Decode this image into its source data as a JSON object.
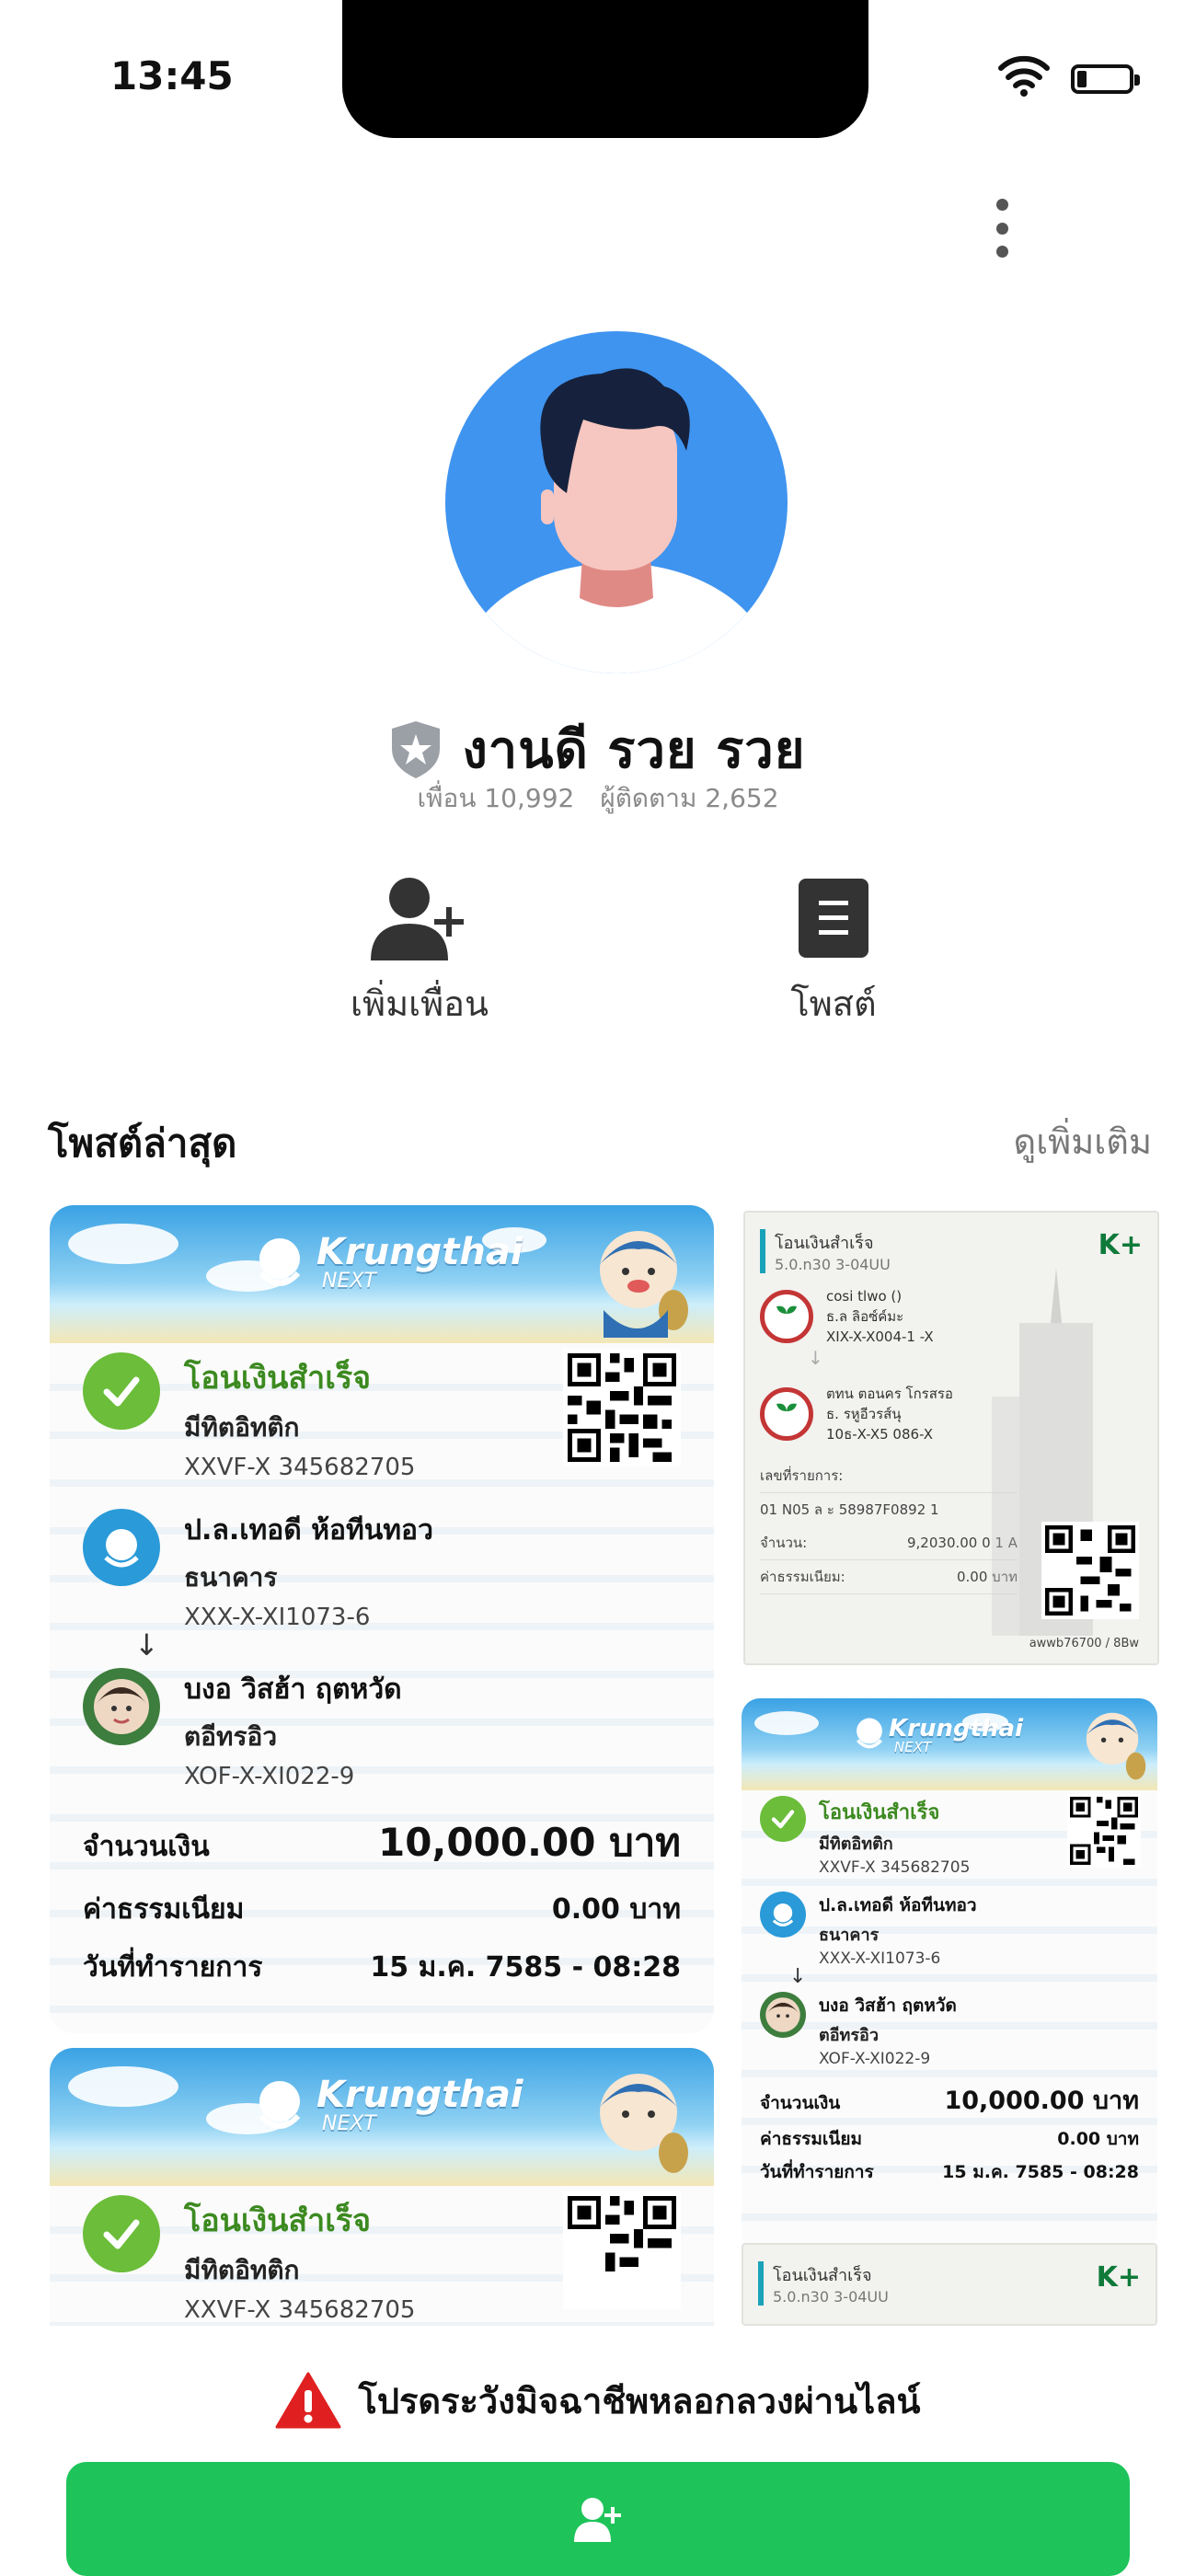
{
  "status_bar": {
    "time": "13:45"
  },
  "profile": {
    "name": "งานดี รวย รวย",
    "friends": "เพื่อน 10,992",
    "followers": "ผู้ติดตาม 2,652"
  },
  "actions": {
    "add_friend": "เพิ่มเพื่อน",
    "post": "โพสต์"
  },
  "posts_section": {
    "title": "โพสต์ล่าสุด",
    "see_more": "ดูเพิ่มเติม"
  },
  "slip": {
    "banner_title": "Krungthai",
    "banner_sub": "NEXT",
    "status": "โอนเงินสำเร็จ",
    "from_name": "มีทิตอิทติก",
    "from_account": "XXVF-X 345682705",
    "to_bank_name": "ป.ล.เทอดี ห้อทีนทอว",
    "to_bank_sub": "ธนาคาร",
    "to_bank_account": "XXX-X-XI1073-6",
    "to_person_name": "บงอ วิสฮ้า ฤตหวัด",
    "to_person_sub": "ตอีทรอิว",
    "to_person_account": "XOF-X-XI022-9",
    "amount_label": "จำนวนเงิน",
    "amount_value": "10,000.00 บาท",
    "fee_label": "ค่าธรรมเนียม",
    "fee_value": "0.00 บาท",
    "date_label": "วันที่ทำรายการ",
    "date_value": "15 ม.ค. 7585 - 08:28"
  },
  "receipt": {
    "title": "โอนเงินสำเร็จ",
    "subtitle": "5.0.n30 3-04UU",
    "brand": "K+",
    "step1_lines": [
      "cosi tlwo ()",
      "ธ.ล ลิอซ์ค์มะ",
      "XIX-X-X004-1 -X"
    ],
    "step2_lines": [
      "ตทน ตอนคร โกรสรอ",
      "ธ. รหูอีวรส์นุ",
      "10ธ-X-X5 086-X"
    ],
    "ref_label": "เลขที่รายการ:",
    "ref_value": "01 N05 ล ะ 58987F0892 1",
    "amount_label": "จำนวน:",
    "amount_value": "9,2030.00 0 1 A",
    "fee_label": "ค่าธรรมเนียม:",
    "fee_value": "0.00 บาท",
    "footer_code": "awwb76700 / 8Bw"
  },
  "footer": {
    "warning": "โปรดระวังมิจฉาชีพหลอกลวงผ่านไลน์"
  },
  "colors": {
    "accent_green": "#1ec45a",
    "avatar_blue": "#3f94f0",
    "warning_red": "#e02020"
  }
}
